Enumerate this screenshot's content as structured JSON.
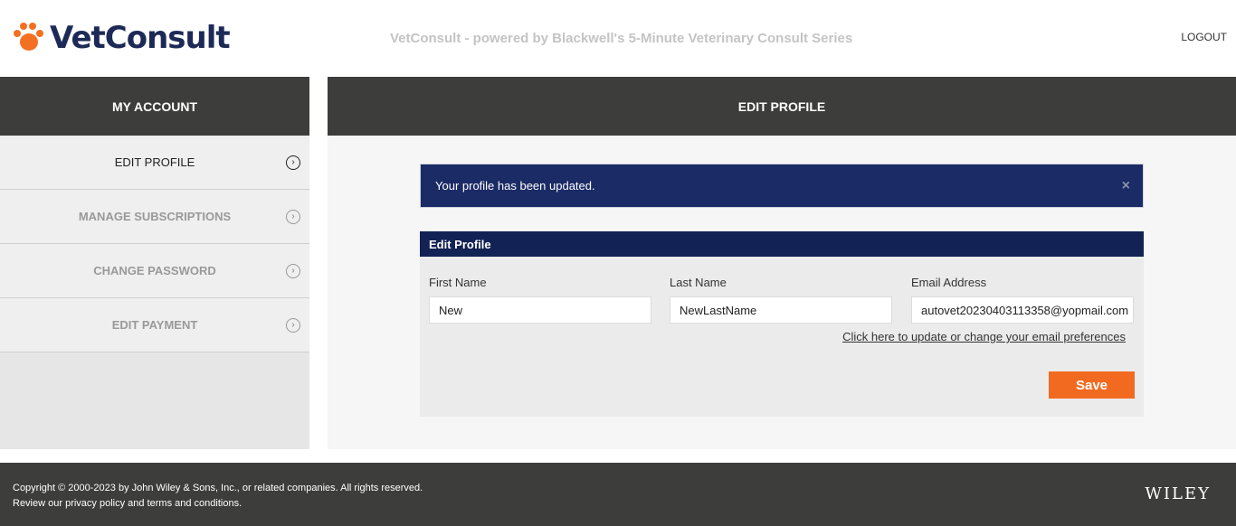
{
  "header": {
    "logo_text": "VetConsult",
    "tagline": "VetConsult - powered by Blackwell's 5-Minute Veterinary Consult Series",
    "logout_label": "LOGOUT"
  },
  "sidebar": {
    "title": "MY ACCOUNT",
    "items": [
      {
        "label": "EDIT PROFILE",
        "active": true,
        "icon": "chevron-right-circle-icon"
      },
      {
        "label": "MANAGE SUBSCRIPTIONS",
        "active": false,
        "icon": "chevron-right-circle-icon"
      },
      {
        "label": "CHANGE PASSWORD",
        "active": false,
        "icon": "chevron-right-circle-icon"
      },
      {
        "label": "EDIT PAYMENT",
        "active": false,
        "icon": "chevron-right-circle-icon"
      }
    ]
  },
  "main": {
    "title": "EDIT PROFILE",
    "alert": {
      "message": "Your profile has been updated.",
      "close_glyph": "×"
    },
    "form": {
      "title": "Edit Profile",
      "first_name": {
        "label": "First Name",
        "value": "New"
      },
      "last_name": {
        "label": "Last Name",
        "value": "NewLastName"
      },
      "email": {
        "label": "Email Address",
        "value": "autovet20230403113358@yopmail.com"
      },
      "email_pref_link": "Click here to update or change your email preferences",
      "save_label": "Save"
    }
  },
  "footer": {
    "copyright": "Copyright © 2000-2023 by John Wiley & Sons, Inc., or related companies. All rights reserved.",
    "review_prefix": "Review our ",
    "privacy_link": "privacy policy",
    "and_text": " and ",
    "terms_link": "terms and conditions",
    "period": ".",
    "wiley_logo": "WILEY"
  },
  "colors": {
    "brand_orange": "#f37021",
    "brand_navy": "#1d2a57",
    "header_dark": "#3d3d3b",
    "alert_navy": "#1b2b66",
    "save_orange": "#f26a1f"
  }
}
